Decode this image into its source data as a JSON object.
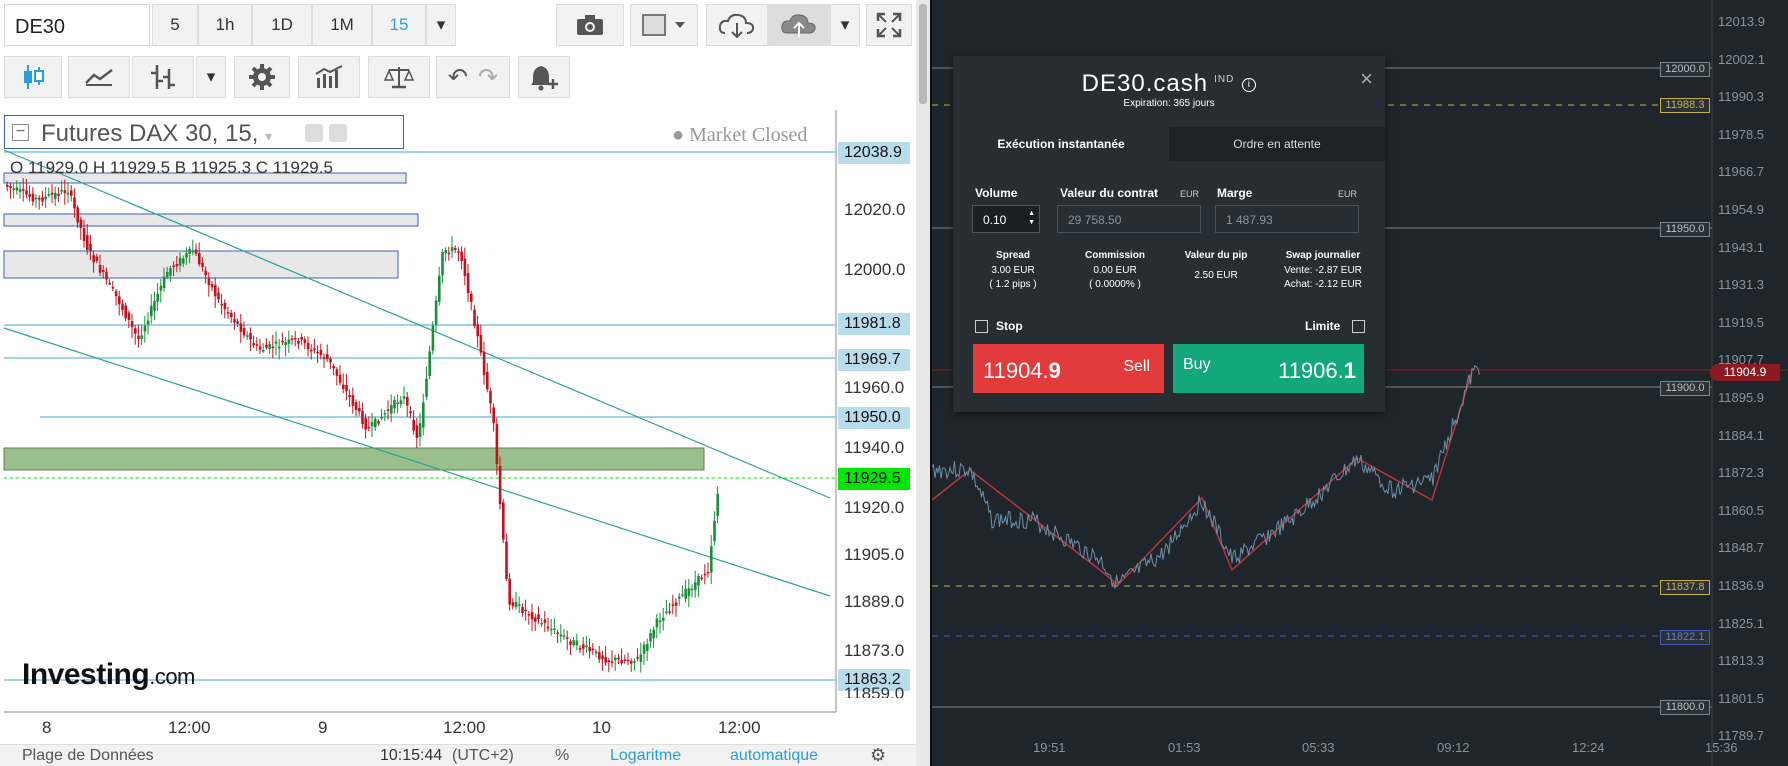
{
  "left": {
    "symbol": "DE30",
    "timeframes": [
      "5",
      "1h",
      "1D",
      "1M",
      "15"
    ],
    "chart_title": "Futures DAX 30, 15,",
    "market_status": "● Market Closed",
    "ohlc": "O 11929.0  H 11929.5  B 11925.3  C 11929.5",
    "logo_main": "Investing",
    "logo_suffix": ".com",
    "price_labels": [
      "12038.9",
      "11981.8",
      "11969.7",
      "11950.0",
      "11929.5",
      "11863.2"
    ],
    "price_ticks": [
      "12020.0",
      "12000.0",
      "11960.0",
      "11940.0",
      "11920.0",
      "11905.0",
      "11889.0",
      "11873.0",
      "11859.0"
    ],
    "x_ticks": [
      "8",
      "12:00",
      "9",
      "12:00",
      "10",
      "12:00"
    ],
    "bottom": {
      "data_range": "Plage de Données",
      "time": "10:15:44",
      "tz": "(UTC+2)",
      "percent": "%",
      "log": "Logaritme",
      "auto": "automatique"
    },
    "colors": {
      "current_price": "#00e600",
      "label_bg": "#b9dcec",
      "up": "#1a8f3a",
      "down": "#c0131f"
    }
  },
  "right": {
    "price_ticks": [
      "12013.9",
      "12002.1",
      "11990.3",
      "11978.5",
      "11966.7",
      "11954.9",
      "11943.1",
      "11931.3",
      "11919.5",
      "11907.7",
      "11895.9",
      "11884.1",
      "11872.3",
      "11860.5",
      "11848.7",
      "11836.9",
      "11825.1",
      "11813.3",
      "11801.5",
      "11789.7"
    ],
    "level_labels": [
      "12000.0",
      "11988.3",
      "11950.0",
      "11900.0",
      "11837.8",
      "11822.1",
      "11800.0"
    ],
    "current_price": "11904.9",
    "x_ticks": [
      "19:51",
      "01:53",
      "05:33",
      "09:12",
      "12:24",
      "15:36"
    ]
  },
  "dialog": {
    "symbol": "DE30.cash",
    "type": "IND",
    "info_icon": "i",
    "expiration": "Expiration: 365 jours",
    "tabs": [
      "Exécution instantanée",
      "Ordre en attente"
    ],
    "volume_label": "Volume",
    "volume_value": "0.10",
    "contract_label": "Valeur du contrat",
    "contract_currency": "EUR",
    "contract_value": "29 758.50",
    "margin_label": "Marge",
    "margin_currency": "EUR",
    "margin_value": "1 487.93",
    "spread_label": "Spread",
    "spread_value": "3.00 EUR",
    "spread_pips": "( 1.2 pips )",
    "commission_label": "Commission",
    "commission_value": "0.00 EUR",
    "commission_pct": "( 0.0000% )",
    "pip_label": "Valeur du pip",
    "pip_value": "2.50 EUR",
    "swap_label": "Swap journalier",
    "swap_sell": "Vente: -2.87 EUR",
    "swap_buy": "Achat: -2.12 EUR",
    "stop_label": "Stop",
    "limit_label": "Limite",
    "sell_label": "Sell",
    "sell_price_main": "11904.",
    "sell_price_big": "9",
    "buy_label": "Buy",
    "buy_price_main": "11906.",
    "buy_price_big": "1",
    "colors": {
      "sell": "#e23b3b",
      "buy": "#12a87c"
    }
  }
}
